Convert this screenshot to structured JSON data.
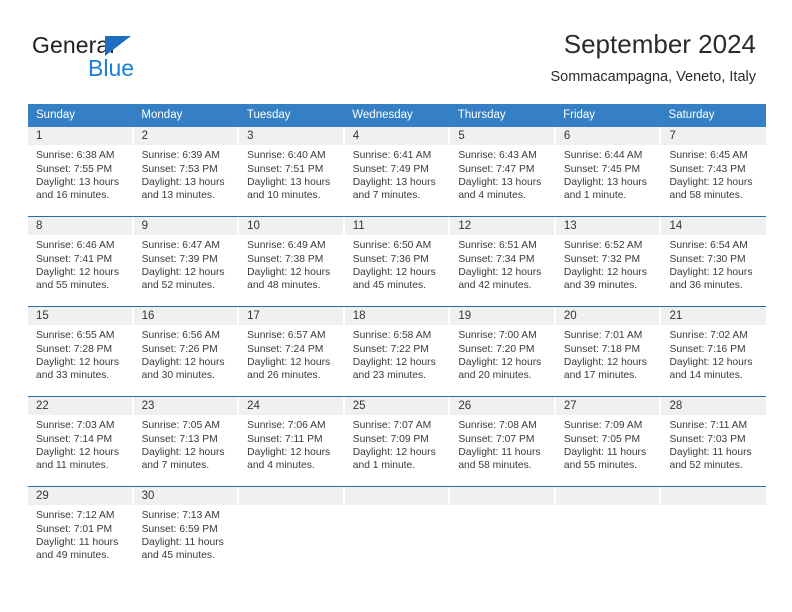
{
  "brand": {
    "name_top": "General",
    "name_bottom": "Blue",
    "triangle_color": "#1b6ec2"
  },
  "header": {
    "title": "September 2024",
    "subtitle": "Sommacampagna, Veneto, Italy"
  },
  "theme": {
    "header_blue": "#3580c4",
    "row_divider_blue": "#2b6cad",
    "daynum_band": "#f0f0f0"
  },
  "weekday_headers": [
    "Sunday",
    "Monday",
    "Tuesday",
    "Wednesday",
    "Thursday",
    "Friday",
    "Saturday"
  ],
  "weeks": [
    [
      {
        "day": "1",
        "sunrise": "Sunrise: 6:38 AM",
        "sunset": "Sunset: 7:55 PM",
        "daylight1": "Daylight: 13 hours",
        "daylight2": "and 16 minutes."
      },
      {
        "day": "2",
        "sunrise": "Sunrise: 6:39 AM",
        "sunset": "Sunset: 7:53 PM",
        "daylight1": "Daylight: 13 hours",
        "daylight2": "and 13 minutes."
      },
      {
        "day": "3",
        "sunrise": "Sunrise: 6:40 AM",
        "sunset": "Sunset: 7:51 PM",
        "daylight1": "Daylight: 13 hours",
        "daylight2": "and 10 minutes."
      },
      {
        "day": "4",
        "sunrise": "Sunrise: 6:41 AM",
        "sunset": "Sunset: 7:49 PM",
        "daylight1": "Daylight: 13 hours",
        "daylight2": "and 7 minutes."
      },
      {
        "day": "5",
        "sunrise": "Sunrise: 6:43 AM",
        "sunset": "Sunset: 7:47 PM",
        "daylight1": "Daylight: 13 hours",
        "daylight2": "and 4 minutes."
      },
      {
        "day": "6",
        "sunrise": "Sunrise: 6:44 AM",
        "sunset": "Sunset: 7:45 PM",
        "daylight1": "Daylight: 13 hours",
        "daylight2": "and 1 minute."
      },
      {
        "day": "7",
        "sunrise": "Sunrise: 6:45 AM",
        "sunset": "Sunset: 7:43 PM",
        "daylight1": "Daylight: 12 hours",
        "daylight2": "and 58 minutes."
      }
    ],
    [
      {
        "day": "8",
        "sunrise": "Sunrise: 6:46 AM",
        "sunset": "Sunset: 7:41 PM",
        "daylight1": "Daylight: 12 hours",
        "daylight2": "and 55 minutes."
      },
      {
        "day": "9",
        "sunrise": "Sunrise: 6:47 AM",
        "sunset": "Sunset: 7:39 PM",
        "daylight1": "Daylight: 12 hours",
        "daylight2": "and 52 minutes."
      },
      {
        "day": "10",
        "sunrise": "Sunrise: 6:49 AM",
        "sunset": "Sunset: 7:38 PM",
        "daylight1": "Daylight: 12 hours",
        "daylight2": "and 48 minutes."
      },
      {
        "day": "11",
        "sunrise": "Sunrise: 6:50 AM",
        "sunset": "Sunset: 7:36 PM",
        "daylight1": "Daylight: 12 hours",
        "daylight2": "and 45 minutes."
      },
      {
        "day": "12",
        "sunrise": "Sunrise: 6:51 AM",
        "sunset": "Sunset: 7:34 PM",
        "daylight1": "Daylight: 12 hours",
        "daylight2": "and 42 minutes."
      },
      {
        "day": "13",
        "sunrise": "Sunrise: 6:52 AM",
        "sunset": "Sunset: 7:32 PM",
        "daylight1": "Daylight: 12 hours",
        "daylight2": "and 39 minutes."
      },
      {
        "day": "14",
        "sunrise": "Sunrise: 6:54 AM",
        "sunset": "Sunset: 7:30 PM",
        "daylight1": "Daylight: 12 hours",
        "daylight2": "and 36 minutes."
      }
    ],
    [
      {
        "day": "15",
        "sunrise": "Sunrise: 6:55 AM",
        "sunset": "Sunset: 7:28 PM",
        "daylight1": "Daylight: 12 hours",
        "daylight2": "and 33 minutes."
      },
      {
        "day": "16",
        "sunrise": "Sunrise: 6:56 AM",
        "sunset": "Sunset: 7:26 PM",
        "daylight1": "Daylight: 12 hours",
        "daylight2": "and 30 minutes."
      },
      {
        "day": "17",
        "sunrise": "Sunrise: 6:57 AM",
        "sunset": "Sunset: 7:24 PM",
        "daylight1": "Daylight: 12 hours",
        "daylight2": "and 26 minutes."
      },
      {
        "day": "18",
        "sunrise": "Sunrise: 6:58 AM",
        "sunset": "Sunset: 7:22 PM",
        "daylight1": "Daylight: 12 hours",
        "daylight2": "and 23 minutes."
      },
      {
        "day": "19",
        "sunrise": "Sunrise: 7:00 AM",
        "sunset": "Sunset: 7:20 PM",
        "daylight1": "Daylight: 12 hours",
        "daylight2": "and 20 minutes."
      },
      {
        "day": "20",
        "sunrise": "Sunrise: 7:01 AM",
        "sunset": "Sunset: 7:18 PM",
        "daylight1": "Daylight: 12 hours",
        "daylight2": "and 17 minutes."
      },
      {
        "day": "21",
        "sunrise": "Sunrise: 7:02 AM",
        "sunset": "Sunset: 7:16 PM",
        "daylight1": "Daylight: 12 hours",
        "daylight2": "and 14 minutes."
      }
    ],
    [
      {
        "day": "22",
        "sunrise": "Sunrise: 7:03 AM",
        "sunset": "Sunset: 7:14 PM",
        "daylight1": "Daylight: 12 hours",
        "daylight2": "and 11 minutes."
      },
      {
        "day": "23",
        "sunrise": "Sunrise: 7:05 AM",
        "sunset": "Sunset: 7:13 PM",
        "daylight1": "Daylight: 12 hours",
        "daylight2": "and 7 minutes."
      },
      {
        "day": "24",
        "sunrise": "Sunrise: 7:06 AM",
        "sunset": "Sunset: 7:11 PM",
        "daylight1": "Daylight: 12 hours",
        "daylight2": "and 4 minutes."
      },
      {
        "day": "25",
        "sunrise": "Sunrise: 7:07 AM",
        "sunset": "Sunset: 7:09 PM",
        "daylight1": "Daylight: 12 hours",
        "daylight2": "and 1 minute."
      },
      {
        "day": "26",
        "sunrise": "Sunrise: 7:08 AM",
        "sunset": "Sunset: 7:07 PM",
        "daylight1": "Daylight: 11 hours",
        "daylight2": "and 58 minutes."
      },
      {
        "day": "27",
        "sunrise": "Sunrise: 7:09 AM",
        "sunset": "Sunset: 7:05 PM",
        "daylight1": "Daylight: 11 hours",
        "daylight2": "and 55 minutes."
      },
      {
        "day": "28",
        "sunrise": "Sunrise: 7:11 AM",
        "sunset": "Sunset: 7:03 PM",
        "daylight1": "Daylight: 11 hours",
        "daylight2": "and 52 minutes."
      }
    ],
    [
      {
        "day": "29",
        "sunrise": "Sunrise: 7:12 AM",
        "sunset": "Sunset: 7:01 PM",
        "daylight1": "Daylight: 11 hours",
        "daylight2": "and 49 minutes."
      },
      {
        "day": "30",
        "sunrise": "Sunrise: 7:13 AM",
        "sunset": "Sunset: 6:59 PM",
        "daylight1": "Daylight: 11 hours",
        "daylight2": "and 45 minutes."
      },
      {
        "day": "",
        "sunrise": "",
        "sunset": "",
        "daylight1": "",
        "daylight2": ""
      },
      {
        "day": "",
        "sunrise": "",
        "sunset": "",
        "daylight1": "",
        "daylight2": ""
      },
      {
        "day": "",
        "sunrise": "",
        "sunset": "",
        "daylight1": "",
        "daylight2": ""
      },
      {
        "day": "",
        "sunrise": "",
        "sunset": "",
        "daylight1": "",
        "daylight2": ""
      },
      {
        "day": "",
        "sunrise": "",
        "sunset": "",
        "daylight1": "",
        "daylight2": ""
      }
    ]
  ]
}
